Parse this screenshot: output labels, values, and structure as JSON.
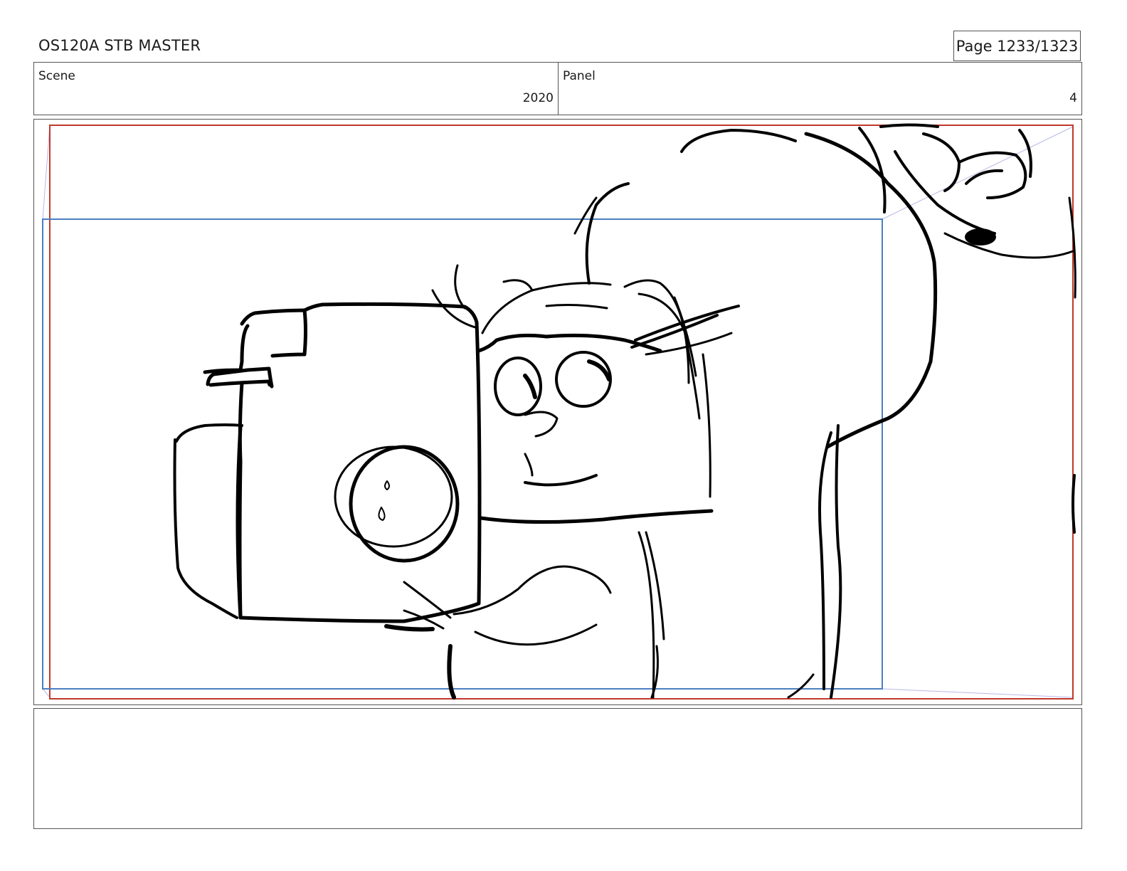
{
  "header": {
    "title": "OS120A STB MASTER",
    "page": "Page 1233/1323"
  },
  "scene": {
    "label": "Scene",
    "value": "2020"
  },
  "panel": {
    "label": "Panel",
    "value": "4"
  },
  "frame_colors": {
    "safe_area": "#c0392b",
    "camera_field": "#4a7fc1",
    "guide": "#b8b8e8",
    "ink": "#000000"
  }
}
